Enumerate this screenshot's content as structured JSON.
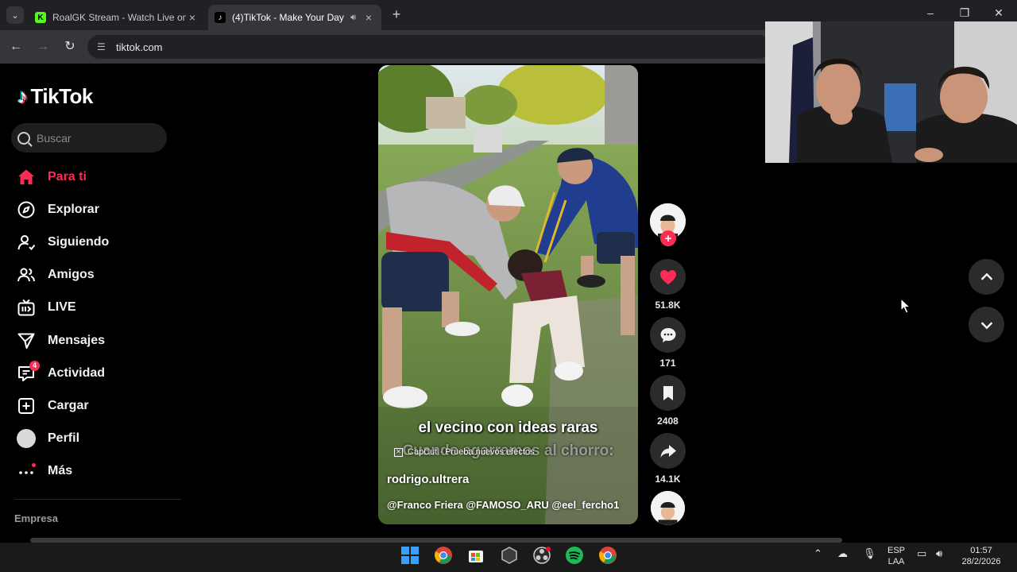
{
  "browser": {
    "tabs": [
      {
        "title": "RoalGK Stream - Watch Live on",
        "favicon": "kick-logo"
      },
      {
        "title": "(4)TikTok - Make Your Day",
        "favicon": "tiktok-logo",
        "audio": true
      }
    ],
    "url": "tiktok.com"
  },
  "sidebar": {
    "logo": "TikTok",
    "search_placeholder": "Buscar",
    "items": [
      {
        "label": "Para ti",
        "icon": "home-icon",
        "active": true
      },
      {
        "label": "Explorar",
        "icon": "compass-icon"
      },
      {
        "label": "Siguiendo",
        "icon": "following-icon"
      },
      {
        "label": "Amigos",
        "icon": "friends-icon"
      },
      {
        "label": "LIVE",
        "icon": "live-tv-icon"
      },
      {
        "label": "Mensajes",
        "icon": "send-icon"
      },
      {
        "label": "Actividad",
        "icon": "activity-icon",
        "badge": "4"
      },
      {
        "label": "Cargar",
        "icon": "upload-icon"
      },
      {
        "label": "Perfil",
        "icon": "profile-avatar"
      },
      {
        "label": "Más",
        "icon": "more-icon"
      }
    ],
    "section": "Empresa"
  },
  "video": {
    "caption_line1": "el vecino con ideas raras",
    "caption_line2": "Cuando agarramos al chorro:",
    "watermark": "CapCut · Prueba nuevos efectos",
    "author": "rodrigo.ultrera",
    "mentions": "@Franco Friera @FAMOSO_ARU @eel_fercho1"
  },
  "actions": {
    "likes": "51.8K",
    "comments": "171",
    "saves": "2408",
    "shares": "14.1K"
  },
  "taskbar": {
    "lang_top": "ESP",
    "lang_bottom": "LAA",
    "time": "01:57",
    "date": "28/2/2026"
  },
  "colors": {
    "accent": "#fe2c55",
    "background": "#000000",
    "chrome_dark": "#202124",
    "chrome_toolbar": "#35363a"
  }
}
